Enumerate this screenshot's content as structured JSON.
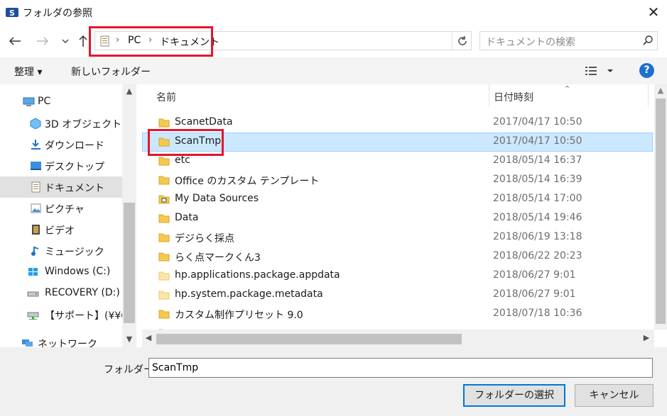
{
  "window": {
    "title": "フォルダの参照"
  },
  "address": {
    "crumbs": [
      "PC",
      "ドキュメント"
    ]
  },
  "search": {
    "placeholder": "ドキュメントの検索"
  },
  "toolbar": {
    "organize": "整理 ▾",
    "new_folder": "新しいフォルダー"
  },
  "nav": {
    "items": [
      {
        "label": "PC",
        "icon": "pc-icon"
      },
      {
        "label": "3D オブジェクト",
        "icon": "3d-objects-icon"
      },
      {
        "label": "ダウンロード",
        "icon": "downloads-icon"
      },
      {
        "label": "デスクトップ",
        "icon": "desktop-icon"
      },
      {
        "label": "ドキュメント",
        "icon": "documents-icon",
        "selected": true
      },
      {
        "label": "ピクチャ",
        "icon": "pictures-icon"
      },
      {
        "label": "ビデオ",
        "icon": "videos-icon"
      },
      {
        "label": "ミュージック",
        "icon": "music-icon"
      },
      {
        "label": "Windows (C:)",
        "icon": "windows-drive-icon"
      },
      {
        "label": "RECOVERY (D:)",
        "icon": "drive-icon"
      },
      {
        "label": "【サポート】(¥¥OCI",
        "icon": "network-drive-icon"
      },
      {
        "label": "ネットワーク",
        "icon": "network-icon"
      }
    ]
  },
  "columns": {
    "name": "名前",
    "date": "日付時刻"
  },
  "files": [
    {
      "name": "ScanetData",
      "date": "2017/04/17 10:50"
    },
    {
      "name": "ScanTmp",
      "date": "2017/04/17 10:50",
      "selected": true
    },
    {
      "name": "etc",
      "date": "2018/05/14 16:37"
    },
    {
      "name": "Office のカスタム テンプレート",
      "date": "2018/05/14 16:39"
    },
    {
      "name": "My Data Sources",
      "date": "2018/05/14 17:00"
    },
    {
      "name": "Data",
      "date": "2018/05/14 19:46"
    },
    {
      "name": "デジらく採点",
      "date": "2018/06/19 13:18"
    },
    {
      "name": "らく点マークくん3",
      "date": "2018/06/22 20:23"
    },
    {
      "name": "hp.applications.package.appdata",
      "date": "2018/06/27 9:01"
    },
    {
      "name": "hp.system.package.metadata",
      "date": "2018/06/27 9:01"
    },
    {
      "name": "カスタム制作プリセット 9.0",
      "date": "2018/07/18 10:36"
    }
  ],
  "bottom": {
    "folder_label": "フォルダー:",
    "folder_value": "ScanTmp",
    "select_button": "フォルダーの選択",
    "cancel_button": "キャンセル"
  },
  "colors": {
    "highlight": "#e3172d",
    "selection": "#cce8ff",
    "accent": "#0078d7"
  }
}
